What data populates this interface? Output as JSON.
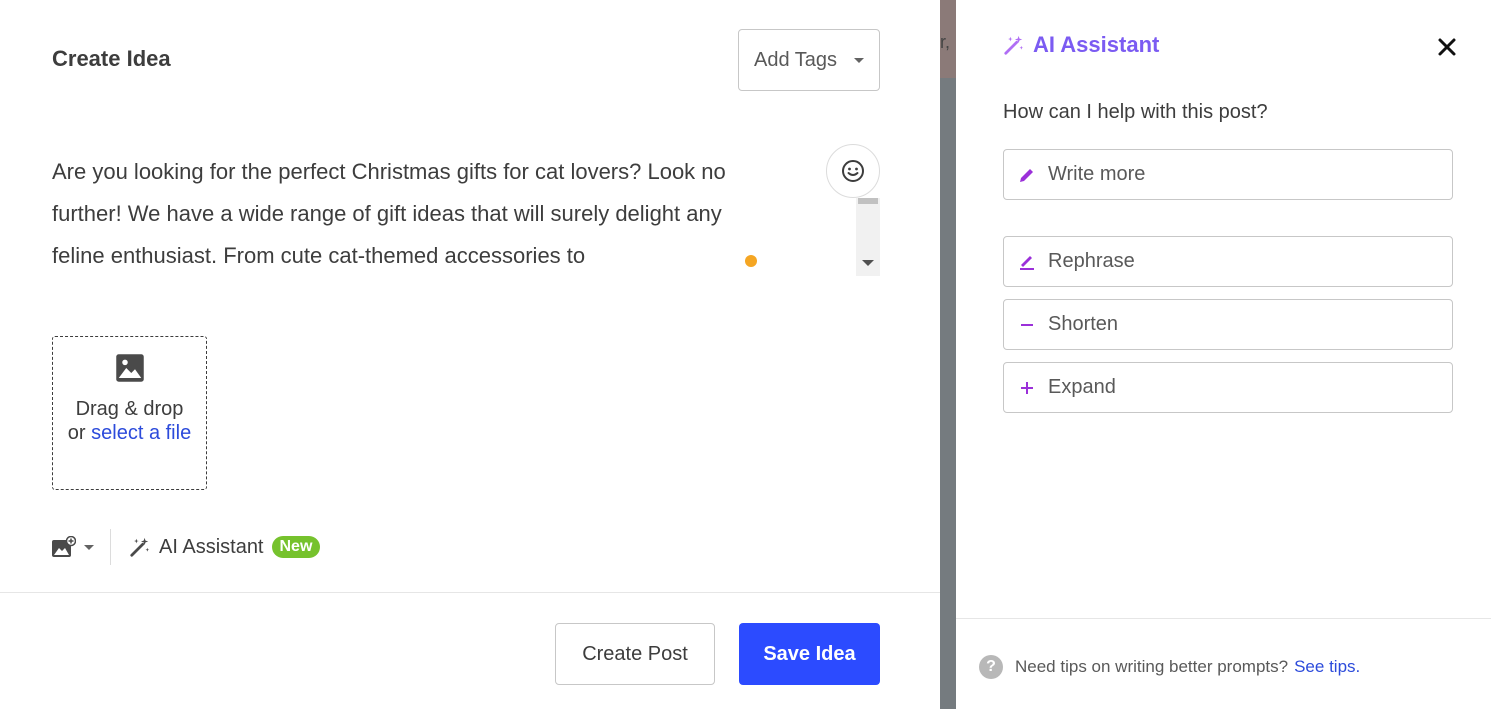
{
  "idea": {
    "title": "Create Idea",
    "add_tags_label": "Add Tags",
    "body_text": "Are you looking for the perfect Christmas gifts for cat lovers? Look no further! We have a wide range of gift ideas that will surely delight any feline enthusiast. From cute cat-themed accessories to",
    "dropzone": {
      "line1": "Drag & drop",
      "or": "or ",
      "link": "select a file"
    },
    "toolbar": {
      "ai_label": "AI Assistant",
      "new_badge": "New"
    },
    "create_post_label": "Create Post",
    "save_idea_label": "Save Idea"
  },
  "backdrop": {
    "bleed_char": "r,"
  },
  "ai_panel": {
    "title": "AI Assistant",
    "question": "How can I help with this post?",
    "options": [
      {
        "label": "Write more",
        "icon": "pencil-icon"
      },
      {
        "label": "Rephrase",
        "icon": "rephrase-icon"
      },
      {
        "label": "Shorten",
        "icon": "minus-icon"
      },
      {
        "label": "Expand",
        "icon": "plus-icon"
      }
    ],
    "tips_text": "Need tips on writing better prompts?",
    "tips_link": "See tips."
  },
  "colors": {
    "primary_button": "#2c4bff",
    "ai_accent": "#7b5bf2",
    "new_badge": "#76c22d",
    "link": "#2c4bdb"
  }
}
